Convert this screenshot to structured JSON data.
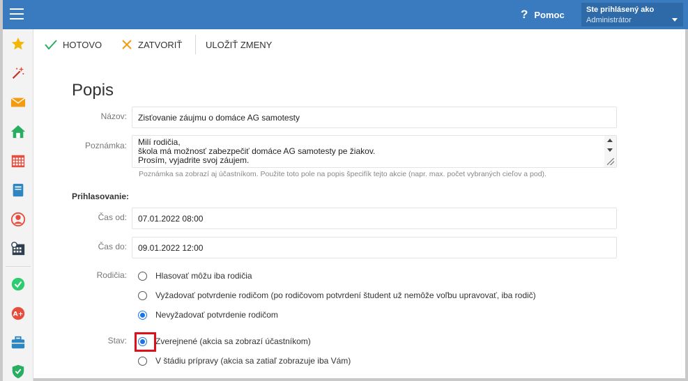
{
  "header": {
    "help_label": "Pomoc",
    "user_line1": "Ste prihlásený ako",
    "user_line2": "Administrátor"
  },
  "sidebar": {
    "items": [
      {
        "icon": "star-icon",
        "color": "#f2b705"
      },
      {
        "icon": "magic-wand-icon",
        "color": "#e74c3c"
      },
      {
        "icon": "envelope-icon",
        "color": "#f39c12"
      },
      {
        "icon": "home-icon",
        "color": "#27ae60"
      },
      {
        "icon": "calendar-grid-icon",
        "color": "#e74c3c"
      },
      {
        "icon": "notebook-icon",
        "color": "#2e86c1"
      },
      {
        "icon": "person-icon",
        "color": "#e74c3c"
      },
      {
        "icon": "schedule-calendar-icon",
        "color": "#2c3e50"
      },
      {
        "icon": "check-circle-icon",
        "color": "#2ecc71"
      },
      {
        "icon": "grade-badge-icon",
        "color": "#e74c3c"
      },
      {
        "icon": "briefcase-icon",
        "color": "#2e86c1"
      },
      {
        "icon": "shield-check-icon",
        "color": "#27ae60"
      }
    ]
  },
  "toolbar": {
    "done_label": "HOTOVO",
    "close_label": "ZATVORIŤ",
    "save_label": "ULOŽIŤ ZMENY"
  },
  "form": {
    "title": "Popis",
    "name_label": "Názov:",
    "name_value": "Zisťovanie záujmu o domáce AG samotesty",
    "note_label": "Poznámka:",
    "note_lines": [
      "Milí rodičia,",
      "škola má možnosť zabezpečiť domáce AG samotesty pe žiakov.",
      "Prosím, vyjadrite svoj záujem."
    ],
    "note_hint": "Poznámka sa zobrazí aj účastníkom. Použite toto pole na popis špecifík tejto akcie (napr. max. počet vybraných cieľov a pod).",
    "signup_label": "Prihlasovanie:",
    "time_from_label": "Čas od:",
    "time_from_value": "07.01.2022 08:00",
    "time_to_label": "Čas do:",
    "time_to_value": "09.01.2022 12:00",
    "parents_label": "Rodičia:",
    "parents_options": [
      "Hlasovať môžu iba rodičia",
      "Vyžadovať potvrdenie rodičom (po rodičovom potvrdení študent už nemôže voľbu upravovať, iba rodič)",
      "Nevyžadovať potvrdenie rodičom"
    ],
    "parents_selected": 2,
    "status_label": "Stav:",
    "status_options": [
      "Zverejnené (akcia sa zobrazí účastníkom)",
      "V štádiu prípravy (akcia sa zatiaľ zobrazuje iba Vám)"
    ],
    "status_selected": 0
  },
  "colors": {
    "header_bg": "#3a7bbf",
    "user_box_bg": "#2f6aa8",
    "radio_checked": "#1a73e8",
    "highlight": "#e0101a",
    "done_icon": "#27ae60",
    "close_icon": "#f39c12"
  }
}
